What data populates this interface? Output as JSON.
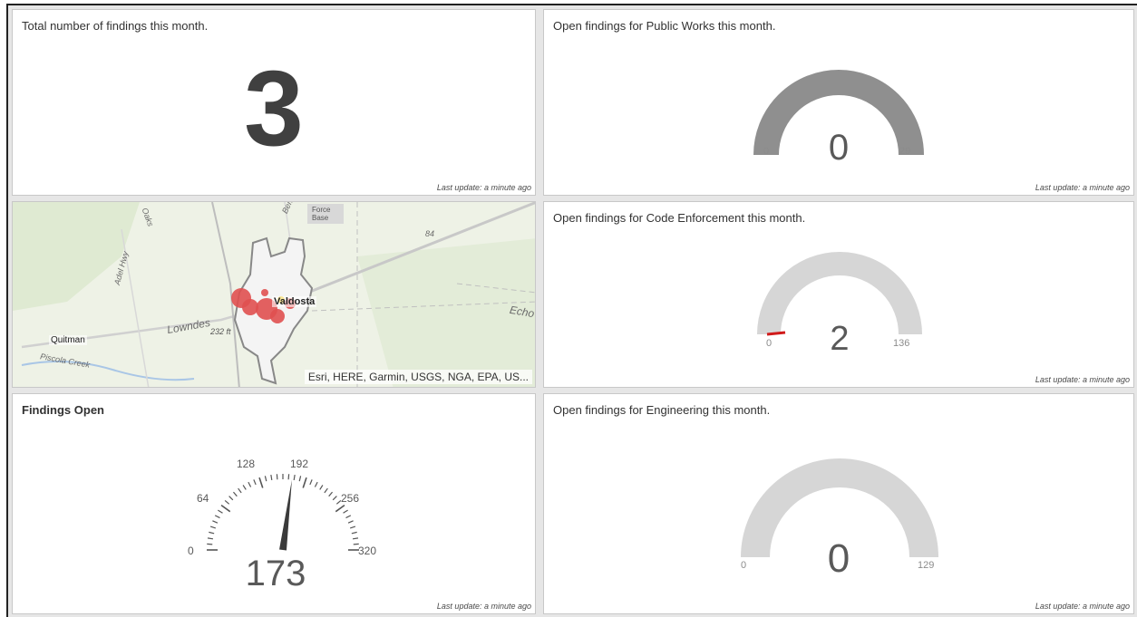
{
  "panels": {
    "total": {
      "title": "Total number of findings this month.",
      "value": "3",
      "last_update": "Last update: a minute ago"
    },
    "public_works": {
      "title": "Open findings for Public Works this month.",
      "value": "0",
      "min": "0",
      "max": "29",
      "fill_fraction": 1.0,
      "fill_color": "#8f8f8f",
      "last_update": "Last update: a minute ago"
    },
    "code_enforcement": {
      "title": "Open findings for Code Enforcement this month.",
      "value": "2",
      "min": "0",
      "max": "136",
      "fill_fraction": 0.015,
      "track_color": "#d6d6d6",
      "fill_color": "#d01a1a",
      "last_update": "Last update: a minute ago"
    },
    "engineering": {
      "title": "Open findings for Engineering this month.",
      "value": "0",
      "min": "0",
      "max": "129",
      "track_color": "#d6d6d6",
      "last_update": "Last update: a minute ago"
    },
    "findings_open": {
      "title": "Findings Open",
      "value": "173",
      "needle_value": 173,
      "scale_max": 320,
      "ticks": [
        "0",
        "64",
        "128",
        "192",
        "256",
        "320"
      ],
      "last_update": "Last update: a minute ago"
    },
    "map": {
      "attribution": "Esri, HERE, Garmin, USGS, NGA, EPA, US...",
      "labels": {
        "force_base": "Force Base",
        "quitman": "Quitman",
        "lowndes": "Lowndes",
        "elevation": "232 ft",
        "echo": "Echo",
        "piscola": "Piscola Creek",
        "valdosta": "Valdosta",
        "hwy_84": "84",
        "adel_hwy": "Adel Hwy",
        "bemiss": "Bemiss Rd",
        "oaks": "Oaks"
      },
      "marker_color": "#e05050",
      "accent_marker_color": "#f2c200"
    }
  }
}
